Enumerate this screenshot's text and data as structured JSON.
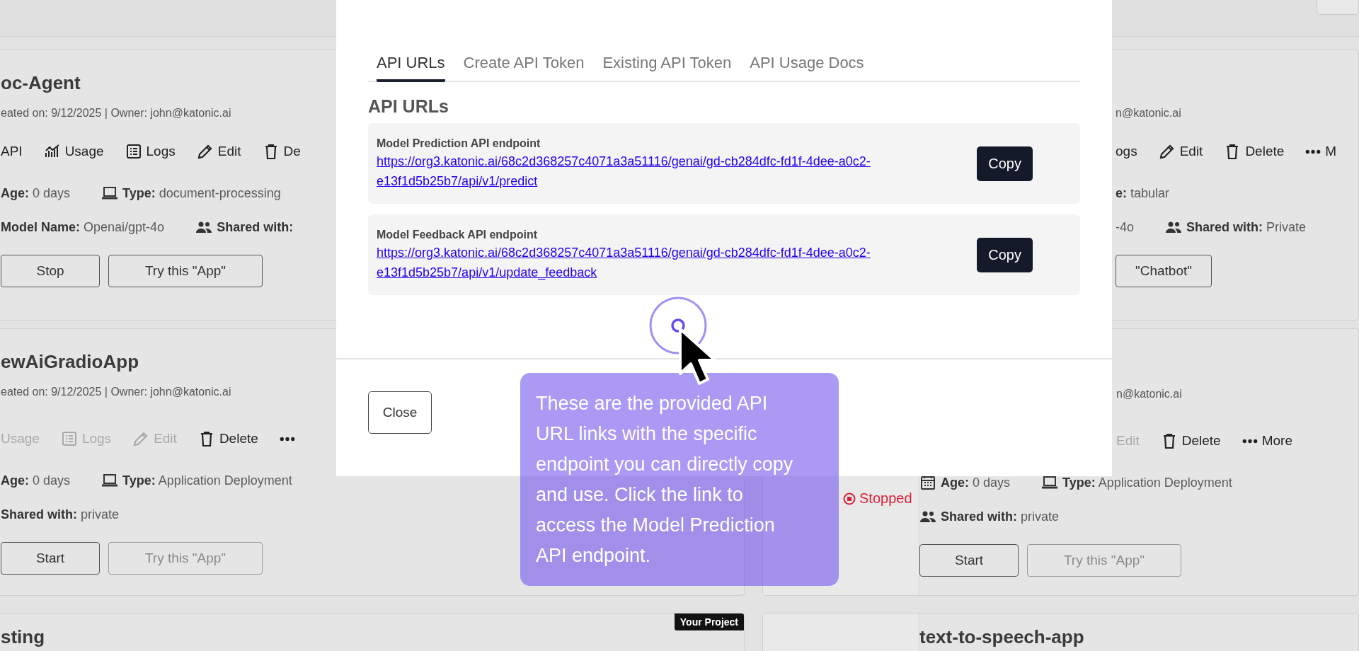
{
  "cards": [
    {
      "title": "oc-Agent",
      "meta": "eated on: 9/12/2025 | Owner: john@katonic.ai",
      "actions": [
        {
          "label": "API",
          "kind": "text",
          "disabled": false
        },
        {
          "label": "Usage",
          "kind": "usage",
          "disabled": false
        },
        {
          "label": "Logs",
          "kind": "logs",
          "disabled": false
        },
        {
          "label": "Edit",
          "kind": "edit",
          "disabled": false
        },
        {
          "label": "De",
          "kind": "delete",
          "disabled": false
        }
      ],
      "details": [
        [
          {
            "kind": "text",
            "label": "Age:",
            "value": "0 days"
          },
          {
            "kind": "type",
            "label": "Type:",
            "value": "document-processing"
          }
        ],
        [
          {
            "kind": "text",
            "label": "Model Name:",
            "value": "Openai/gpt-4o"
          },
          {
            "kind": "shared",
            "label": "Shared with:"
          }
        ]
      ],
      "buttons": [
        {
          "label": "Stop",
          "disabled": false
        },
        {
          "label": "Try this \"App\"",
          "disabled": false
        }
      ]
    },
    {
      "title": "ewAiGradioApp",
      "meta": "eated on: 9/12/2025 | Owner: john@katonic.ai",
      "actions": [
        {
          "label": "Usage",
          "kind": "text",
          "disabled": true
        },
        {
          "label": "Logs",
          "kind": "logs",
          "disabled": true
        },
        {
          "label": "Edit",
          "kind": "edit",
          "disabled": true
        },
        {
          "label": "Delete",
          "kind": "delete",
          "disabled": false
        },
        {
          "kind": "more",
          "disabled": false
        }
      ],
      "details": [
        [
          {
            "kind": "text",
            "label": "Age:",
            "value": "0 days"
          },
          {
            "kind": "type",
            "label": "Type:",
            "value": "Application Deployment"
          }
        ],
        [
          {
            "kind": "text",
            "label": "Shared with:",
            "value": "private"
          }
        ]
      ],
      "buttons": [
        {
          "label": "Start",
          "disabled": false
        },
        {
          "label": "Try this \"App\"",
          "disabled": true
        }
      ]
    },
    {
      "badge": "Your Project",
      "title": "sting"
    },
    {
      "meta": "n@katonic.ai",
      "actions": [
        {
          "label": "ogs",
          "kind": "text",
          "disabled": false
        },
        {
          "label": "Edit",
          "kind": "edit",
          "disabled": false
        },
        {
          "label": "Delete",
          "kind": "delete",
          "disabled": false
        },
        {
          "label": "M",
          "kind": "more",
          "disabled": false
        }
      ],
      "details": [
        [
          {
            "kind": "text",
            "label": "e:",
            "value": "tabular"
          }
        ],
        [
          {
            "kind": "text",
            "value": "-4o"
          },
          {
            "kind": "shared",
            "label": "Shared with:",
            "value": "Private"
          }
        ]
      ],
      "buttons": [
        {
          "label": "\"Chatbot\"",
          "disabled": false
        }
      ]
    },
    {
      "status": "Stopped",
      "meta": "n@katonic.ai",
      "actions": [
        {
          "label": "Edit",
          "kind": "text",
          "disabled": true
        },
        {
          "label": "Delete",
          "kind": "delete",
          "disabled": false
        },
        {
          "label": "More",
          "kind": "more",
          "disabled": false
        }
      ],
      "details": [
        [
          {
            "kind": "age",
            "label": "Age:",
            "value": "0 days"
          },
          {
            "kind": "type",
            "label": "Type:",
            "value": "Application Deployment"
          }
        ],
        [
          {
            "kind": "shared",
            "label": "Shared with:",
            "value": "private"
          }
        ]
      ],
      "buttons": [
        {
          "label": "Start",
          "disabled": false
        },
        {
          "label": "Try this \"App\"",
          "disabled": true
        }
      ]
    },
    {
      "title": "text-to-speech-app"
    }
  ],
  "modal": {
    "tabs": [
      {
        "label": "API URLs",
        "selected": true
      },
      {
        "label": "Create API Token",
        "selected": false
      },
      {
        "label": "Existing API Token",
        "selected": false
      },
      {
        "label": "API Usage Docs",
        "selected": false
      }
    ],
    "heading": "API URLs",
    "endpoints": [
      {
        "label": "Model Prediction API endpoint",
        "url": "https://org3.katonic.ai/68c2d368257c4071a3a51116/genai/gd-cb284dfc-fd1f-4dee-a0c2-e13f1d5b25b7/api/v1/predict",
        "button": "Copy"
      },
      {
        "label": "Model Feedback API endpoint",
        "url": "https://org3.katonic.ai/68c2d368257c4071a3a51116/genai/gd-cb284dfc-fd1f-4dee-a0c2-e13f1d5b25b7/api/v1/update_feedback",
        "button": "Copy"
      }
    ],
    "close_button": "Close"
  },
  "tooltip": {
    "text": "These are the provided API URL links with the specific endpoint you can directly copy and use. Click the link to access the Model Prediction API endpoint."
  }
}
